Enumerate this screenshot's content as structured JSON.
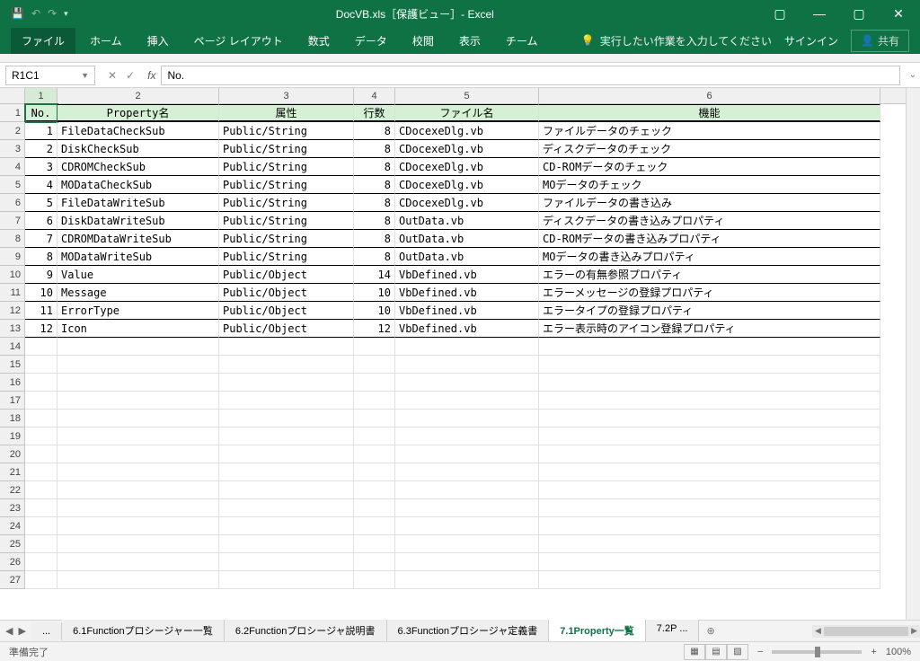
{
  "titlebar": {
    "title": "DocVB.xls［保護ビュー］- Excel"
  },
  "ribbon": {
    "tabs": [
      "ファイル",
      "ホーム",
      "挿入",
      "ページ レイアウト",
      "数式",
      "データ",
      "校閲",
      "表示",
      "チーム"
    ],
    "tell_me": "実行したい作業を入力してください",
    "signin": "サインイン",
    "share": "共有"
  },
  "name_box": "R1C1",
  "formula": "No.",
  "col_headers": [
    "1",
    "2",
    "3",
    "4",
    "5",
    "6"
  ],
  "row_headers": [
    "1",
    "2",
    "3",
    "4",
    "5",
    "6",
    "7",
    "8",
    "9",
    "10",
    "11",
    "12",
    "13",
    "14",
    "15",
    "16",
    "17",
    "18",
    "19",
    "20",
    "21",
    "22",
    "23",
    "24",
    "25",
    "26",
    "27"
  ],
  "table_header": [
    "No.",
    "Property名",
    "属性",
    "行数",
    "ファイル名",
    "機能"
  ],
  "chart_data": {
    "type": "table",
    "columns": [
      "No.",
      "Property名",
      "属性",
      "行数",
      "ファイル名",
      "機能"
    ],
    "rows": [
      [
        1,
        "FileDataCheckSub",
        "Public/String",
        8,
        "CDocexeDlg.vb",
        "ファイルデータのチェック"
      ],
      [
        2,
        "DiskCheckSub",
        "Public/String",
        8,
        "CDocexeDlg.vb",
        "ディスクデータのチェック"
      ],
      [
        3,
        "CDROMCheckSub",
        "Public/String",
        8,
        "CDocexeDlg.vb",
        "CD-ROMデータのチェック"
      ],
      [
        4,
        "MODataCheckSub",
        "Public/String",
        8,
        "CDocexeDlg.vb",
        "MOデータのチェック"
      ],
      [
        5,
        "FileDataWriteSub",
        "Public/String",
        8,
        "CDocexeDlg.vb",
        "ファイルデータの書き込み"
      ],
      [
        6,
        "DiskDataWriteSub",
        "Public/String",
        8,
        "OutData.vb",
        "ディスクデータの書き込みプロパティ"
      ],
      [
        7,
        "CDROMDataWriteSub",
        "Public/String",
        8,
        "OutData.vb",
        "CD-ROMデータの書き込みプロパティ"
      ],
      [
        8,
        "MODataWriteSub",
        "Public/String",
        8,
        "OutData.vb",
        "MOデータの書き込みプロパティ"
      ],
      [
        9,
        "Value",
        "Public/Object",
        14,
        "VbDefined.vb",
        "エラーの有無参照プロパティ"
      ],
      [
        10,
        "Message",
        "Public/Object",
        10,
        "VbDefined.vb",
        "エラーメッセージの登録プロパティ"
      ],
      [
        11,
        "ErrorType",
        "Public/Object",
        10,
        "VbDefined.vb",
        "エラータイプの登録プロパティ"
      ],
      [
        12,
        "Icon",
        "Public/Object",
        12,
        "VbDefined.vb",
        "エラー表示時のアイコン登録プロパティ"
      ]
    ]
  },
  "sheet_tabs": {
    "overflow": "...",
    "tabs": [
      "6.1Functionプロシージャー一覧",
      "6.2Functionプロシージャ説明書",
      "6.3Functionプロシージャ定義書",
      "7.1Property一覧",
      "7.2P ..."
    ],
    "active": 3
  },
  "status": {
    "left": "準備完了",
    "zoom": "100%"
  }
}
